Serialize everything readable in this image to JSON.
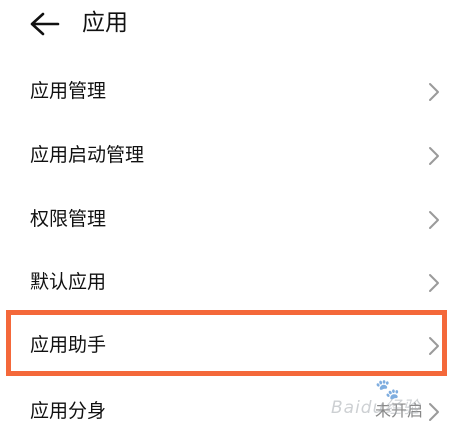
{
  "header": {
    "title": "应用",
    "back_icon": "back-arrow-icon"
  },
  "items": [
    {
      "label": "应用管理",
      "value": ""
    },
    {
      "label": "应用启动管理",
      "value": ""
    },
    {
      "label": "权限管理",
      "value": ""
    },
    {
      "label": "默认应用",
      "value": ""
    },
    {
      "label": "应用助手",
      "value": "",
      "highlighted": true
    },
    {
      "label": "应用分身",
      "value": "未开启"
    }
  ],
  "highlight_color": "#f4683a",
  "watermark": {
    "text": "Baidu经验"
  }
}
